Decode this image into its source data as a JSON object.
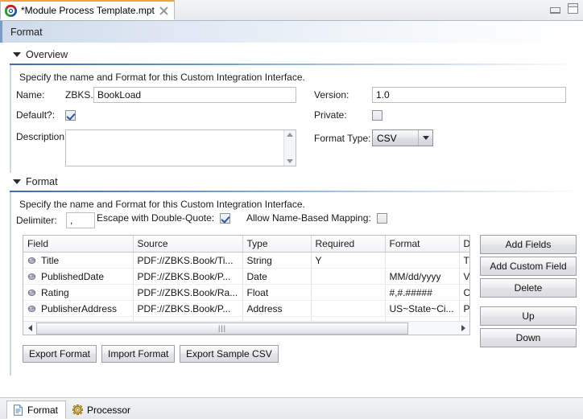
{
  "window": {
    "tab_title": "*Module Process Template.mpt",
    "logo_icon": "app-logo-icon",
    "close_icon": "close-icon",
    "minimize_icon": "minimize-icon",
    "maximize_icon": "maximize-icon"
  },
  "form": {
    "title": "Format"
  },
  "overview": {
    "section_label": "Overview",
    "description": "Specify the name and Format for this Custom Integration Interface.",
    "name_label": "Name:",
    "name_prefix": "ZBKS.",
    "name_value": "BookLoad",
    "version_label": "Version:",
    "version_value": "1.0",
    "default_label": "Default?:",
    "default_checked": true,
    "private_label": "Private:",
    "private_checked": false,
    "description_label": "Description:",
    "description_value": "",
    "format_type_label": "Format Type:",
    "format_type_value": "CSV"
  },
  "format": {
    "section_label": "Format",
    "description": "Specify the name and Format for this Custom Integration Interface.",
    "delimiter_label": "Delimiter:",
    "delimiter_value": ",",
    "escape_label": "Escape with Double-Quote:",
    "escape_checked": true,
    "mapping_label": "Allow Name-Based Mapping:",
    "mapping_checked": false,
    "columns": [
      "Field",
      "Source",
      "Type",
      "Required",
      "Format",
      "D"
    ],
    "rows": [
      {
        "icon": "field-sphere-icon",
        "field": "Title",
        "source": "PDF://ZBKS.Book/Ti...",
        "type": "String",
        "required": "Y",
        "format": "",
        "d": "T"
      },
      {
        "icon": "field-sphere-icon",
        "field": "PublishedDate",
        "source": "PDF://ZBKS.Book/P...",
        "type": "Date",
        "required": "",
        "format": "MM/dd/yyyy",
        "d": "V"
      },
      {
        "icon": "field-sphere-icon",
        "field": "Rating",
        "source": "PDF://ZBKS.Book/Ra...",
        "type": "Float",
        "required": "",
        "format": "#,#.#####",
        "d": "C"
      },
      {
        "icon": "field-sphere-icon",
        "field": "PublisherAddress",
        "source": "PDF://ZBKS.Book/P...",
        "type": "Address",
        "required": "",
        "format": "US~State~Ci...",
        "d": "P"
      }
    ],
    "side_buttons": [
      "Add Fields",
      "Add Custom Field",
      "Delete",
      "Up",
      "Down"
    ],
    "bottom_buttons": [
      "Export Format",
      "Import Format",
      "Export Sample CSV"
    ]
  },
  "bottom_tabs": [
    {
      "label": "Format",
      "icon": "document-icon",
      "active": true
    },
    {
      "label": "Processor",
      "icon": "gear-icon",
      "active": false
    }
  ]
}
